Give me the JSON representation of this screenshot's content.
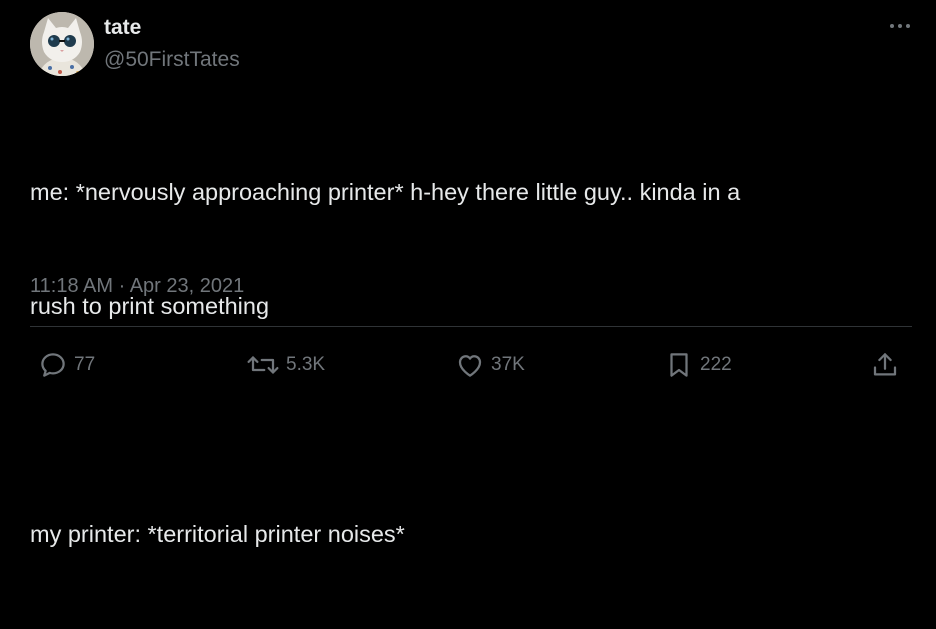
{
  "author": {
    "display_name": "tate",
    "handle": "@50FirstTates",
    "avatar_alt": "cat wearing sunglasses"
  },
  "more_icon": "more-horizontal-icon",
  "tweet": {
    "text_lines": [
      "me: *nervously approaching printer* h-hey there little guy.. kinda in a",
      "rush to print something",
      "",
      "my printer: *territorial printer noises*"
    ],
    "time": "11:18 AM",
    "separator": "·",
    "date": "Apr 23, 2021"
  },
  "actions": {
    "reply": {
      "icon": "reply-icon",
      "count": "77"
    },
    "retweet": {
      "icon": "retweet-icon",
      "count": "5.3K"
    },
    "like": {
      "icon": "like-icon",
      "count": "37K"
    },
    "bookmark": {
      "icon": "bookmark-icon",
      "count": "222"
    },
    "share": {
      "icon": "share-icon"
    }
  },
  "colors": {
    "background": "#000000",
    "text_primary": "#e7e9ea",
    "text_secondary": "#71767b",
    "divider": "#2f3336"
  }
}
